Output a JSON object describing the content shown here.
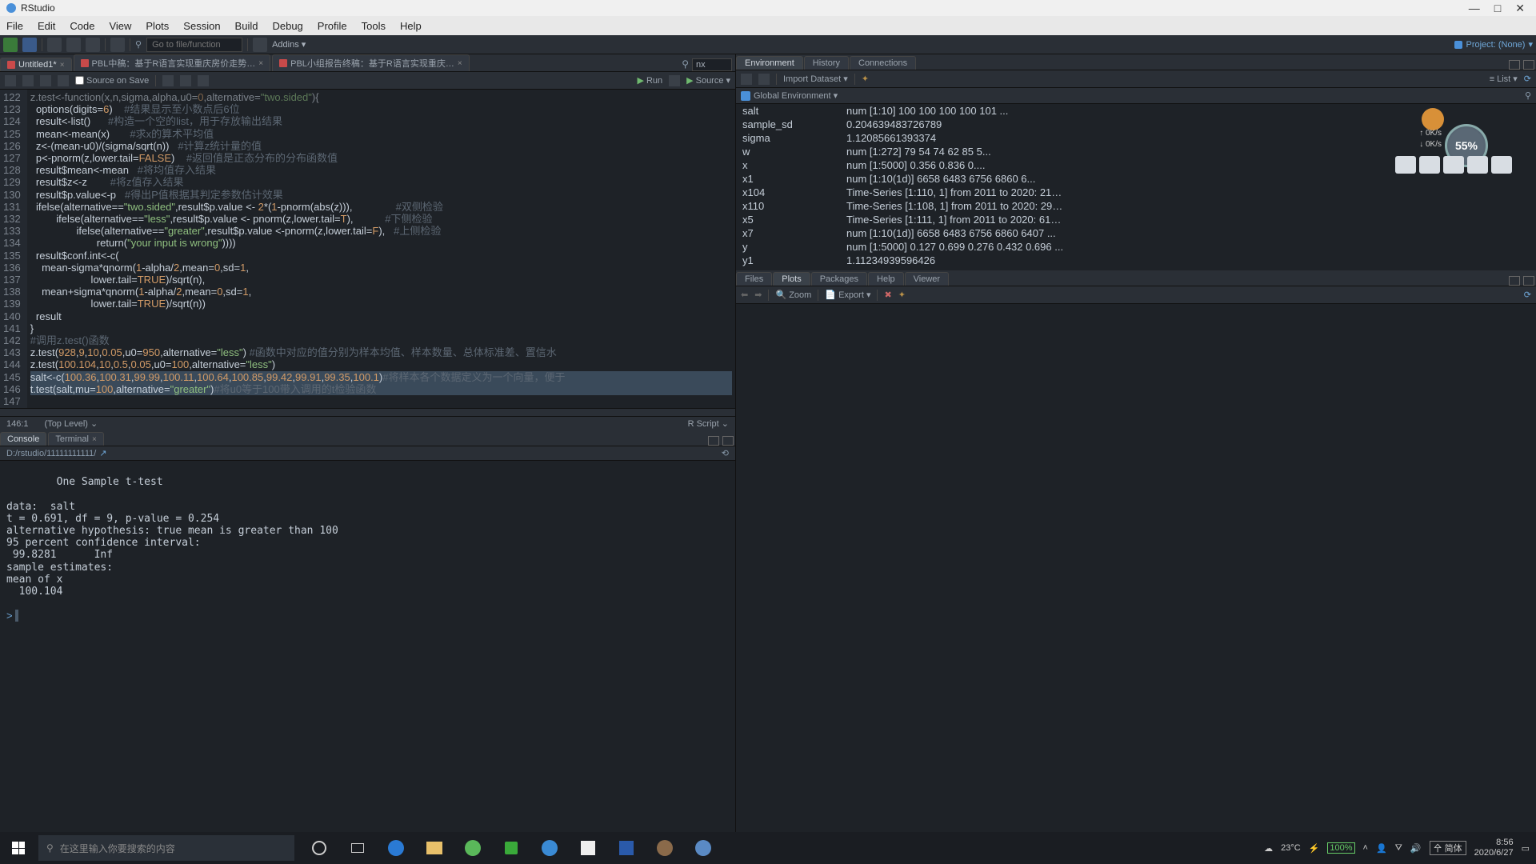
{
  "window": {
    "title": "RStudio"
  },
  "menubar": [
    "File",
    "Edit",
    "Code",
    "View",
    "Plots",
    "Session",
    "Build",
    "Debug",
    "Profile",
    "Tools",
    "Help"
  ],
  "toolbar": {
    "goto_placeholder": "Go to file/function",
    "addins": "Addins",
    "project": "Project: (None)"
  },
  "source_tabs": [
    {
      "label": "Untitled1*",
      "active": true
    },
    {
      "label": "PBL中稿：基于R语言实现重庆房价走势…",
      "active": false
    },
    {
      "label": "PBL小组报告终稿：基于R语言实现重庆…",
      "active": false
    }
  ],
  "source_search": "nx",
  "source_toolbar": {
    "source_on_save": "Source on Save",
    "run": "Run",
    "source": "Source"
  },
  "code_start_line": 122,
  "code_lines": [
    {
      "raw": "z.test<-function(x,n,sigma,alpha,u0=0,alternative=\"two.sided\"){",
      "truncated": true
    },
    {
      "raw": "  options(digits=6)    #结果显示至小数点后6位"
    },
    {
      "raw": "  result<-list()      #构造一个空的list，用于存放输出结果"
    },
    {
      "raw": "  mean<-mean(x)       #求x的算术平均值"
    },
    {
      "raw": "  z<-(mean-u0)/(sigma/sqrt(n))   #计算z统计量的值"
    },
    {
      "raw": "  p<-pnorm(z,lower.tail=FALSE)    #返回值是正态分布的分布函数值"
    },
    {
      "raw": "  result$mean<-mean   #将均值存入结果"
    },
    {
      "raw": "  result$z<-z        #将z值存入结果"
    },
    {
      "raw": "  result$p.value<-p   #得出P值根据其判定参数估计效果"
    },
    {
      "raw": "  ifelse(alternative==\"two.sided\",result$p.value <- 2*(1-pnorm(abs(z))),               #双侧检验"
    },
    {
      "raw": "         ifelse(alternative==\"less\",result$p.value <- pnorm(z,lower.tail=T),           #下侧检验"
    },
    {
      "raw": "                ifelse(alternative==\"greater\",result$p.value <-pnorm(z,lower.tail=F),   #上侧检验"
    },
    {
      "raw": "                       return(\"your input is wrong\"))))"
    },
    {
      "raw": "  result$conf.int<-c("
    },
    {
      "raw": "    mean-sigma*qnorm(1-alpha/2,mean=0,sd=1,"
    },
    {
      "raw": "                     lower.tail=TRUE)/sqrt(n),"
    },
    {
      "raw": "    mean+sigma*qnorm(1-alpha/2,mean=0,sd=1,"
    },
    {
      "raw": "                     lower.tail=TRUE)/sqrt(n))"
    },
    {
      "raw": "  result"
    },
    {
      "raw": "}"
    },
    {
      "raw": "#调用z.test()函数"
    },
    {
      "raw": "z.test(928,9,10,0.05,u0=950,alternative=\"less\") #函数中对应的值分别为样本均值、样本数量、总体标准差、置信水"
    },
    {
      "raw": "z.test(100.104,10,0.5,0.05,u0=100,alternative=\"less\")"
    },
    {
      "raw": ""
    },
    {
      "raw": "salt<-c(100.36,100.31,99.99,100.11,100.64,100.85,99.42,99.91,99.35,100.1)#将样本各个数据定义为一个向量，便于",
      "sel": true
    },
    {
      "raw": "t.test(salt,mu=100,alternative=\"greater\")#将u0等于100带入调用的t检验函数",
      "sel": true
    },
    {
      "raw": ""
    }
  ],
  "status": {
    "pos": "146:1",
    "scope": "(Top Level)",
    "lang": "R Script"
  },
  "console_tabs": [
    "Console",
    "Terminal"
  ],
  "console_path": "D:/rstudio/11111111111/",
  "console_lines": [
    "",
    "        One Sample t-test",
    "",
    "data:  salt",
    "t = 0.691, df = 9, p-value = 0.254",
    "alternative hypothesis: true mean is greater than 100",
    "95 percent confidence interval:",
    " 99.8281      Inf",
    "sample estimates:",
    "mean of x",
    "  100.104",
    ""
  ],
  "console_prompt": "> ",
  "env_tabs": [
    "Environment",
    "History",
    "Connections"
  ],
  "env_toolbar": {
    "import": "Import Dataset",
    "list": "List"
  },
  "env_scope": "Global Environment",
  "env_vars": [
    {
      "k": "salt",
      "v": "num [1:10] 100 100 100 100 101 ..."
    },
    {
      "k": "sample_sd",
      "v": "0.204639483726789"
    },
    {
      "k": "sigma",
      "v": "1.12085661393374"
    },
    {
      "k": "w",
      "v": "num [1:272] 79 54 74 62 85 5..."
    },
    {
      "k": "x",
      "v": "num [1:5000] 0.356 0.836 0...."
    },
    {
      "k": "x1",
      "v": "num [1:10(1d)] 6658 6483 6756 6860 6..."
    },
    {
      "k": "x104",
      "v": "Time-Series [1:110, 1] from 2011 to 2020: 21…"
    },
    {
      "k": "x110",
      "v": "Time-Series [1:108, 1] from 2011 to 2020: 29…"
    },
    {
      "k": "x5",
      "v": "Time-Series [1:111, 1] from 2011 to 2020: 61…"
    },
    {
      "k": "x7",
      "v": "num [1:10(1d)] 6658 6483 6756 6860 6407 ..."
    },
    {
      "k": "y",
      "v": "num [1:5000] 0.127 0.699 0.276 0.432 0.696 ..."
    },
    {
      "k": "y1",
      "v": "1.11234939596426"
    }
  ],
  "plot_tabs": [
    "Files",
    "Plots",
    "Packages",
    "Help",
    "Viewer"
  ],
  "plot_toolbar": {
    "zoom": "Zoom",
    "export": "Export"
  },
  "taskbar": {
    "search_placeholder": "在这里输入你要搜索的内容",
    "weather": "23°C",
    "battery": "100%",
    "ime": "简体",
    "time": "8:56",
    "date": "2020/6/27"
  },
  "gauge": {
    "pct": "55%",
    "up": "0K/s",
    "down": "0K/s"
  }
}
